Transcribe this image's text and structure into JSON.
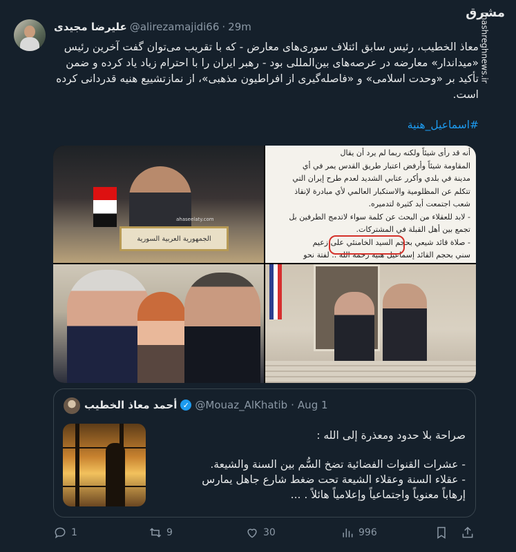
{
  "tweet": {
    "author_name": "علیرضا مجیدی",
    "handle": "@alirezamajidi66",
    "separator": "·",
    "time": "29m",
    "text": "معاذ الخطیب، رئیس سابق ائتلاف سوری‌های معارض - که با تقریب می‌توان گفت آخرین رئیس «میداندار» معارضه در عرصه‌های بین‌المللی بود - رهبر ایران را با احترام زیاد یاد کرده و ضمن تأکید بر «وحدت اسلامی» و «فاصله‌گیری از افراطیون مذهبی»، از نمازتشییع هنیه قدردانی کرده است.",
    "hashtag": "#اسماعیل_هنیة"
  },
  "watermark": {
    "logo_text": "مشرق",
    "site": "mashreghnews.ir"
  },
  "media": {
    "photo1_sign": "الجمهورية العربية السورية",
    "photo1_watermark": "ahaseelaty.com",
    "photo2_lines": [
      "أنه قد رأى شيئاً ولكنه ربما لم يرد أن يقال",
      "المقاومة شيئاً وأرفض اعتبار طريق القدس يمر في أي",
      "مدينة في بلدي وأكرر عتابي الشديد لعدم طرح إيران التي",
      "تتكلم عن المظلومية والاستكبار العالمي لأي مبادرة لإنقاذ",
      "شعب اجتمعت أيد كثيرة لتدميره.",
      "- لابد للعقلاء من البحث عن كلمة سواء لاتدمج الطرفين بل",
      "تجمع بين أهل القبلة في المشتركات.",
      "- صلاة قائد شيعي بحجم السيد الخامنئي على زعيم",
      "سني بحجم القائد إسماعيل هنيه رحمه الله .. لفتة نحو"
    ]
  },
  "quote": {
    "author_name": "أحمد معاذ الخطيب",
    "handle": "@Mouaz_AlKhatib",
    "separator": "·",
    "time": "Aug 1",
    "line1": "صراحة بلا حدود ومعذرة إلى الله :",
    "line2": "- عشرات القنوات الفضائية تضخ السُّم بين السنة والشيعة.",
    "line3": "- عقلاء السنة وعقلاء الشيعة تحت ضغط شارع جاهل يمارس",
    "line4": "إرهاباً معنوياً واجتماعياً وإعلامياً هائلاً . ..."
  },
  "actions": {
    "replies": "1",
    "retweets": "9",
    "likes": "30",
    "views": "996"
  },
  "icons": [
    "reply-icon",
    "retweet-icon",
    "like-icon",
    "views-icon",
    "bookmark-icon",
    "share-icon",
    "verified-badge-icon"
  ]
}
